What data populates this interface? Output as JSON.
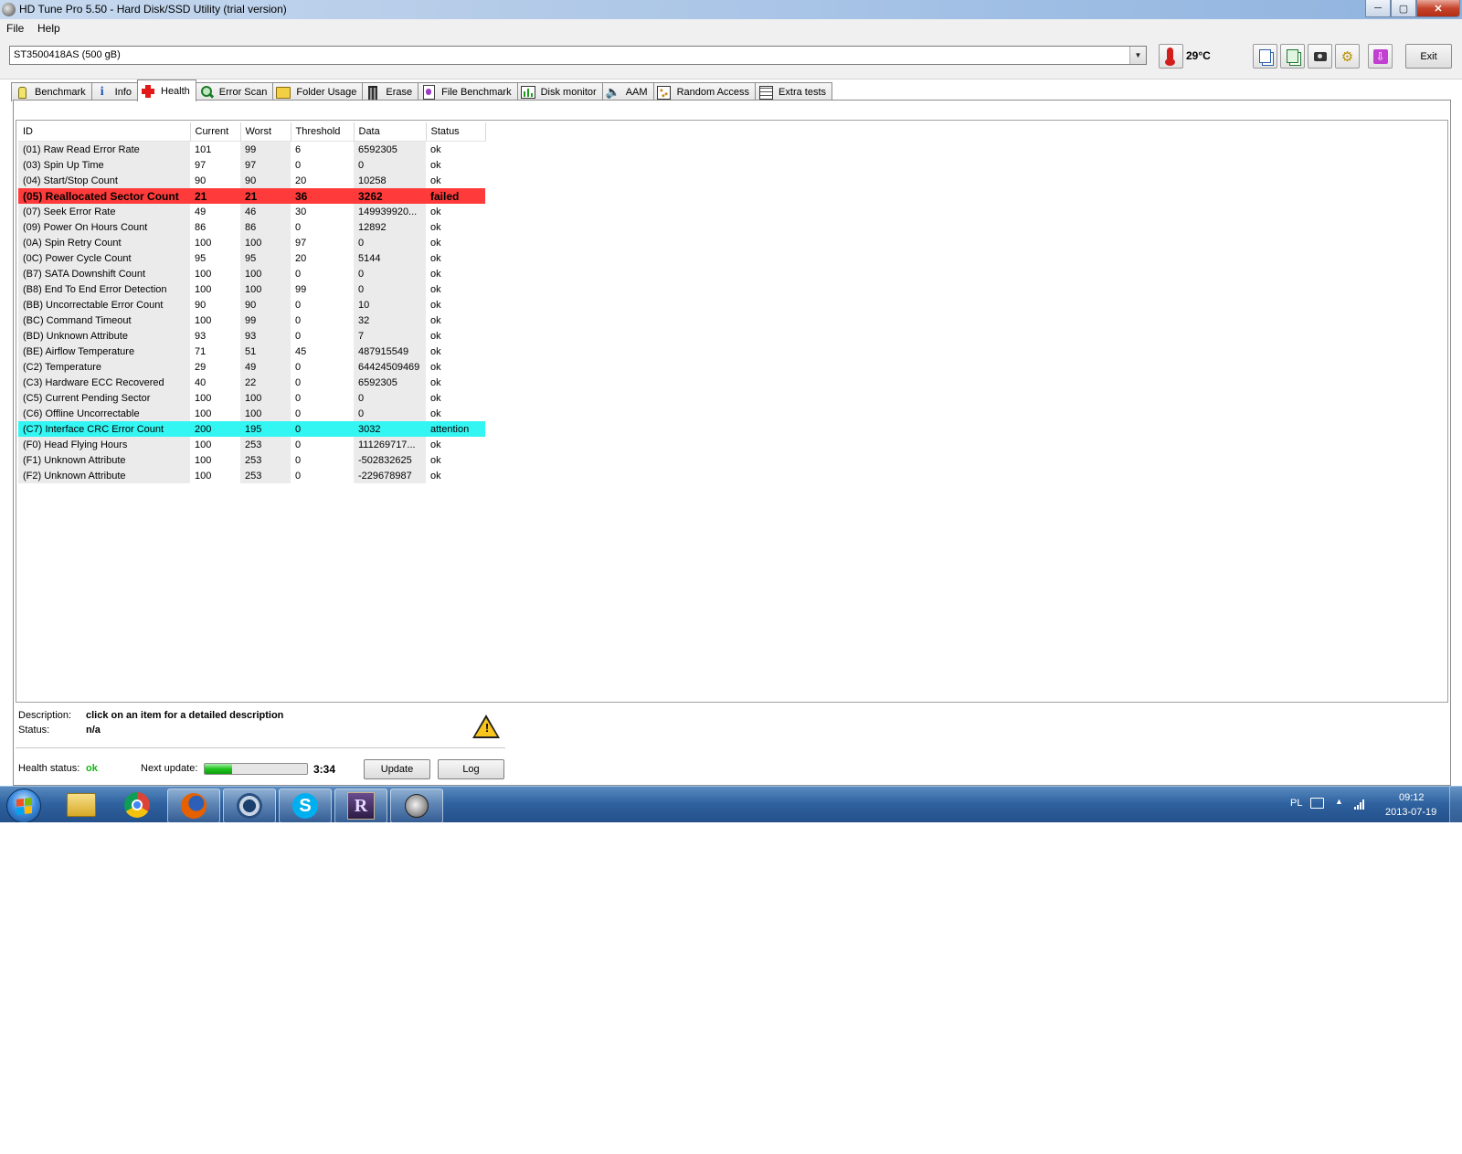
{
  "window": {
    "title": "HD Tune Pro 5.50 - Hard Disk/SSD Utility (trial version)",
    "controls": {
      "minimize": "─",
      "maximize": "▢",
      "close": "✕"
    }
  },
  "menu": {
    "file": "File",
    "help": "Help"
  },
  "toolbar": {
    "drive": "ST3500418AS (500 gB)",
    "temperature": "29°C",
    "exit_label": "Exit",
    "buttons": [
      "copy-info-icon",
      "copy-screen-icon",
      "screenshot-icon",
      "options-icon",
      "save-icon"
    ]
  },
  "tabs": [
    {
      "label": "Benchmark",
      "icon": "benchmark-icon"
    },
    {
      "label": "Info",
      "icon": "info-icon"
    },
    {
      "label": "Health",
      "icon": "health-cross-icon",
      "active": true
    },
    {
      "label": "Error Scan",
      "icon": "magnifier-icon"
    },
    {
      "label": "Folder Usage",
      "icon": "folder-icon"
    },
    {
      "label": "Erase",
      "icon": "trash-icon"
    },
    {
      "label": "File Benchmark",
      "icon": "file-benchmark-icon"
    },
    {
      "label": "Disk monitor",
      "icon": "disk-monitor-icon"
    },
    {
      "label": "AAM",
      "icon": "speaker-icon"
    },
    {
      "label": "Random Access",
      "icon": "random-access-icon"
    },
    {
      "label": "Extra tests",
      "icon": "extra-tests-icon"
    }
  ],
  "health_table": {
    "headers": {
      "id": "ID",
      "current": "Current",
      "worst": "Worst",
      "threshold": "Threshold",
      "data": "Data",
      "status": "Status"
    },
    "rows": [
      {
        "id": "(01) Raw Read Error Rate",
        "current": "101",
        "worst": "99",
        "threshold": "6",
        "data": "6592305",
        "status": "ok"
      },
      {
        "id": "(03) Spin Up Time",
        "current": "97",
        "worst": "97",
        "threshold": "0",
        "data": "0",
        "status": "ok"
      },
      {
        "id": "(04) Start/Stop Count",
        "current": "90",
        "worst": "90",
        "threshold": "20",
        "data": "10258",
        "status": "ok"
      },
      {
        "id": "(05) Reallocated Sector Count",
        "current": "21",
        "worst": "21",
        "threshold": "36",
        "data": "3262",
        "status": "failed",
        "highlight": "failed"
      },
      {
        "id": "(07) Seek Error Rate",
        "current": "49",
        "worst": "46",
        "threshold": "30",
        "data": "149939920...",
        "status": "ok"
      },
      {
        "id": "(09) Power On Hours Count",
        "current": "86",
        "worst": "86",
        "threshold": "0",
        "data": "12892",
        "status": "ok"
      },
      {
        "id": "(0A) Spin Retry Count",
        "current": "100",
        "worst": "100",
        "threshold": "97",
        "data": "0",
        "status": "ok"
      },
      {
        "id": "(0C) Power Cycle Count",
        "current": "95",
        "worst": "95",
        "threshold": "20",
        "data": "5144",
        "status": "ok"
      },
      {
        "id": "(B7) SATA Downshift Count",
        "current": "100",
        "worst": "100",
        "threshold": "0",
        "data": "0",
        "status": "ok"
      },
      {
        "id": "(B8) End To End Error Detection",
        "current": "100",
        "worst": "100",
        "threshold": "99",
        "data": "0",
        "status": "ok"
      },
      {
        "id": "(BB) Uncorrectable Error Count",
        "current": "90",
        "worst": "90",
        "threshold": "0",
        "data": "10",
        "status": "ok"
      },
      {
        "id": "(BC) Command Timeout",
        "current": "100",
        "worst": "99",
        "threshold": "0",
        "data": "32",
        "status": "ok"
      },
      {
        "id": "(BD) Unknown Attribute",
        "current": "93",
        "worst": "93",
        "threshold": "0",
        "data": "7",
        "status": "ok"
      },
      {
        "id": "(BE) Airflow Temperature",
        "current": "71",
        "worst": "51",
        "threshold": "45",
        "data": "487915549",
        "status": "ok"
      },
      {
        "id": "(C2) Temperature",
        "current": "29",
        "worst": "49",
        "threshold": "0",
        "data": "64424509469",
        "status": "ok"
      },
      {
        "id": "(C3) Hardware ECC Recovered",
        "current": "40",
        "worst": "22",
        "threshold": "0",
        "data": "6592305",
        "status": "ok"
      },
      {
        "id": "(C5) Current Pending Sector",
        "current": "100",
        "worst": "100",
        "threshold": "0",
        "data": "0",
        "status": "ok"
      },
      {
        "id": "(C6) Offline Uncorrectable",
        "current": "100",
        "worst": "100",
        "threshold": "0",
        "data": "0",
        "status": "ok"
      },
      {
        "id": "(C7) Interface CRC Error Count",
        "current": "200",
        "worst": "195",
        "threshold": "0",
        "data": "3032",
        "status": "attention",
        "highlight": "attention"
      },
      {
        "id": "(F0) Head Flying Hours",
        "current": "100",
        "worst": "253",
        "threshold": "0",
        "data": "111269717...",
        "status": "ok"
      },
      {
        "id": "(F1) Unknown Attribute",
        "current": "100",
        "worst": "253",
        "threshold": "0",
        "data": "-502832625",
        "status": "ok"
      },
      {
        "id": "(F2) Unknown Attribute",
        "current": "100",
        "worst": "253",
        "threshold": "0",
        "data": "-229678987",
        "status": "ok"
      }
    ]
  },
  "description": {
    "description_label": "Description:",
    "description_value": "click on an item for a detailed description",
    "status_label": "Status:",
    "status_value": "n/a",
    "warning_icon": "warning-triangle-icon"
  },
  "health_footer": {
    "health_status_label": "Health status:",
    "health_status_value": "ok",
    "next_update_label": "Next update:",
    "next_update_progress": 0.27,
    "countdown": "3:34",
    "update_label": "Update",
    "log_label": "Log"
  },
  "taskbar": {
    "apps": [
      "explorer-icon",
      "chrome-icon",
      "firefox-icon",
      "teamspeak-icon",
      "skype-icon",
      "rift-icon",
      "hdtune-icon"
    ],
    "language": "PL",
    "time": "09:12",
    "date": "2013-07-19"
  },
  "colors": {
    "failed_row": "#ff3a3a",
    "attention_row": "#33f5f2",
    "health_ok": "#11b511",
    "progress_fill": "#1fc41f"
  }
}
